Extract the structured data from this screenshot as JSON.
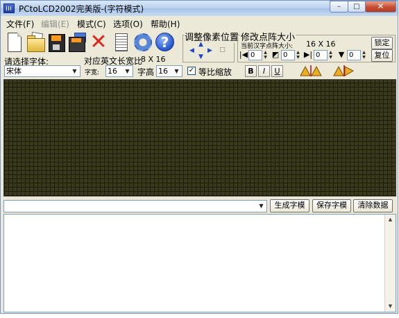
{
  "window": {
    "title": "PCtoLCD2002完美版-(字符模式)",
    "controls": {
      "minimize": "–",
      "maximize": "□",
      "close": "✕"
    }
  },
  "menu": [
    "文件(F)",
    "编辑(E)",
    "模式(C)",
    "选项(O)",
    "帮助(H)"
  ],
  "toolbar": {
    "icons": [
      "new-file-icon",
      "open-folder-icon",
      "save-icon",
      "save-as-icon",
      "delete-icon",
      "properties-icon",
      "settings-gear-icon",
      "help-icon"
    ]
  },
  "font": {
    "label": "请选择字体:",
    "selected": "宋体",
    "en_width_label": "对应英文长宽比",
    "en_ratio": "8 X 16",
    "char_width_label": "字宽:",
    "char_width": "16",
    "char_height_label": "字高",
    "char_height": "16",
    "keep_ratio_label": "等比缩放",
    "keep_ratio_checked": true
  },
  "format_buttons": {
    "bold": "B",
    "italic": "I",
    "underline": "U"
  },
  "pixel_position": {
    "title": "调整像素位置",
    "arrows": {
      "up": "▲",
      "left": "◀",
      "right": "▶",
      "down": "▼",
      "center": "□"
    }
  },
  "dot_matrix": {
    "title": "修改点阵大小",
    "current_label": "当前汉字点阵大小:",
    "current_size": "16 X 16",
    "values": [
      "0",
      "0",
      "0",
      "0"
    ],
    "confirm": "锁定",
    "reset": "复位"
  },
  "actions": {
    "input_value": "",
    "generate": "生成字模",
    "save": "保存字模",
    "clear": "清除数据"
  },
  "colors": {
    "canvas_bg": "#3b3a1a",
    "grid_line": "#1d1d0b",
    "window_bg": "#ece9d8"
  }
}
